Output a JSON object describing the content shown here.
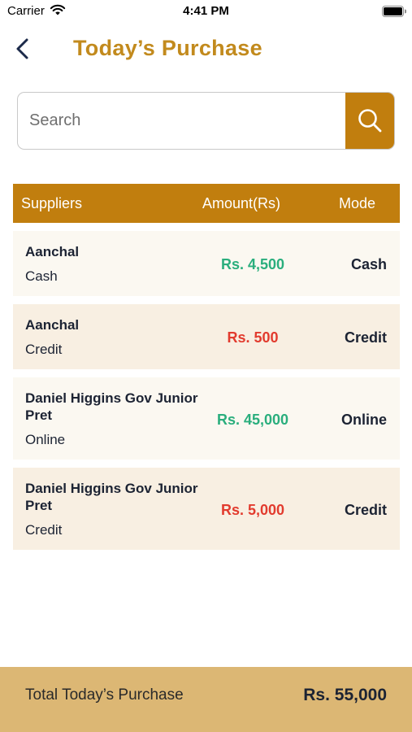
{
  "status_bar": {
    "carrier": "Carrier",
    "time": "4:41 PM"
  },
  "header": {
    "title": "Today’s Purchase",
    "back_icon": "chevron-left-icon"
  },
  "search": {
    "placeholder": "Search",
    "value": "",
    "icon": "search-icon"
  },
  "table": {
    "headers": {
      "suppliers": "Suppliers",
      "amount": "Amount(Rs)",
      "mode": "Mode"
    },
    "rows": [
      {
        "supplier": "Aanchal",
        "sub_mode": "Cash",
        "amount": "Rs. 4,500",
        "mode": "Cash",
        "amount_color": "green"
      },
      {
        "supplier": "Aanchal",
        "sub_mode": "Credit",
        "amount": "Rs. 500",
        "mode": "Credit",
        "amount_color": "red"
      },
      {
        "supplier": "Daniel Higgins Gov Junior Pret",
        "sub_mode": "Online",
        "amount": "Rs. 45,000",
        "mode": "Online",
        "amount_color": "green"
      },
      {
        "supplier": "Daniel Higgins Gov Junior Pret",
        "sub_mode": "Credit",
        "amount": "Rs. 5,000",
        "mode": "Credit",
        "amount_color": "red"
      }
    ]
  },
  "footer": {
    "label": "Total Today’s Purchase",
    "value": "Rs. 55,000"
  },
  "colors": {
    "accent": "#c17e0e",
    "title": "#c28a1d",
    "positive": "#2aae7d",
    "negative": "#e23b2e",
    "footer_bg": "#dcb774"
  }
}
